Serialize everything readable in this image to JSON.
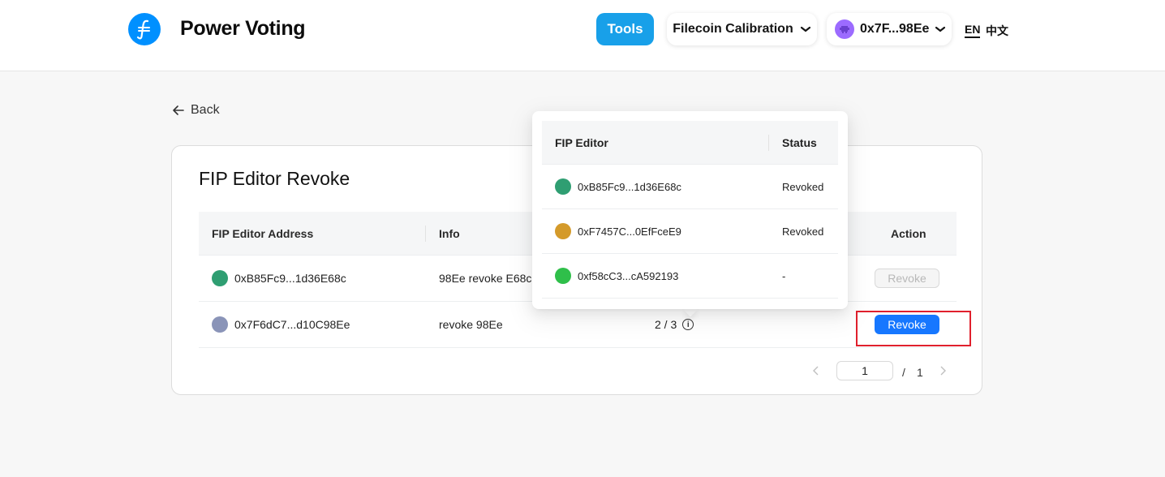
{
  "header": {
    "brand": "Power Voting",
    "tools_label": "Tools",
    "network_label": "Filecoin Calibration",
    "account_label": "0x7F...98Ee",
    "lang_en": "EN",
    "lang_zh": "中文"
  },
  "nav": {
    "back_label": "Back"
  },
  "card": {
    "title": "FIP Editor Revoke",
    "columns": {
      "address": "FIP Editor Address",
      "info": "Info",
      "action": "Action"
    },
    "rows": [
      {
        "address": "0xB85Fc9...1d36E68c",
        "info": "98Ee revoke E68c",
        "progress": "",
        "action": "Revoke",
        "action_enabled": false
      },
      {
        "address": "0x7F6dC7...d10C98Ee",
        "info": "revoke 98Ee",
        "progress": "2 / 3",
        "action": "Revoke",
        "action_enabled": true
      }
    ]
  },
  "pagination": {
    "current": "1",
    "separator": "/",
    "total": "1"
  },
  "popover": {
    "columns": {
      "editor": "FIP Editor",
      "status": "Status"
    },
    "rows": [
      {
        "editor": "0xB85Fc9...1d36E68c",
        "status": "Revoked"
      },
      {
        "editor": "0xF7457C...0EfFceE9",
        "status": "Revoked"
      },
      {
        "editor": "0xf58cC3...cA592193",
        "status": "-"
      }
    ]
  },
  "colors": {
    "brand_blue": "#0090ff",
    "tools_blue": "#18a0e9",
    "primary": "#1677ff",
    "highlight": "#e0202d"
  }
}
